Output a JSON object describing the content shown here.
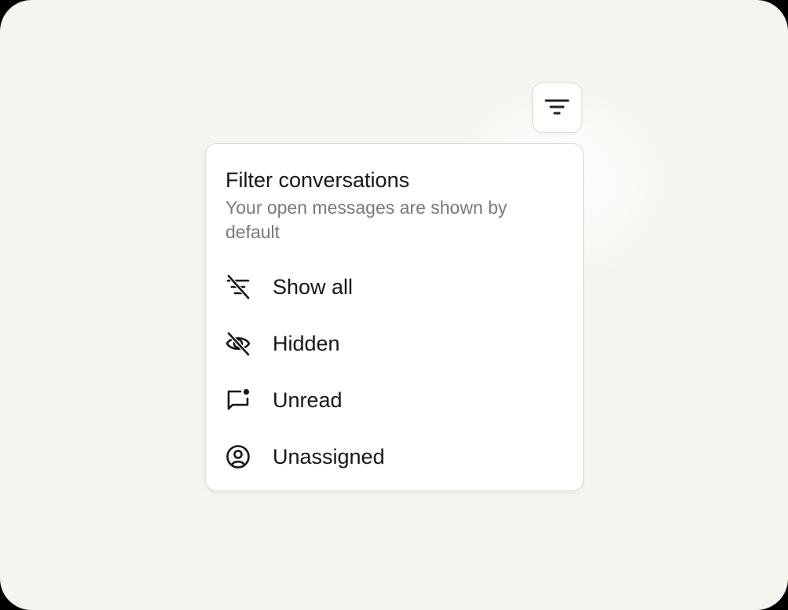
{
  "filter_button": {
    "icon": "filter-lines-icon"
  },
  "menu": {
    "title": "Filter conversations",
    "subtitle": "Your open messages are shown by default",
    "items": [
      {
        "label": "Show all",
        "icon": "filter-off-icon"
      },
      {
        "label": "Hidden",
        "icon": "eye-off-icon"
      },
      {
        "label": "Unread",
        "icon": "message-unread-icon"
      },
      {
        "label": "Unassigned",
        "icon": "user-circle-icon"
      }
    ]
  },
  "colors": {
    "background": "#f5f4ee",
    "surface": "#ffffff",
    "text": "#171717",
    "muted_text": "#7a7a7a",
    "border": "#dcdcda"
  }
}
